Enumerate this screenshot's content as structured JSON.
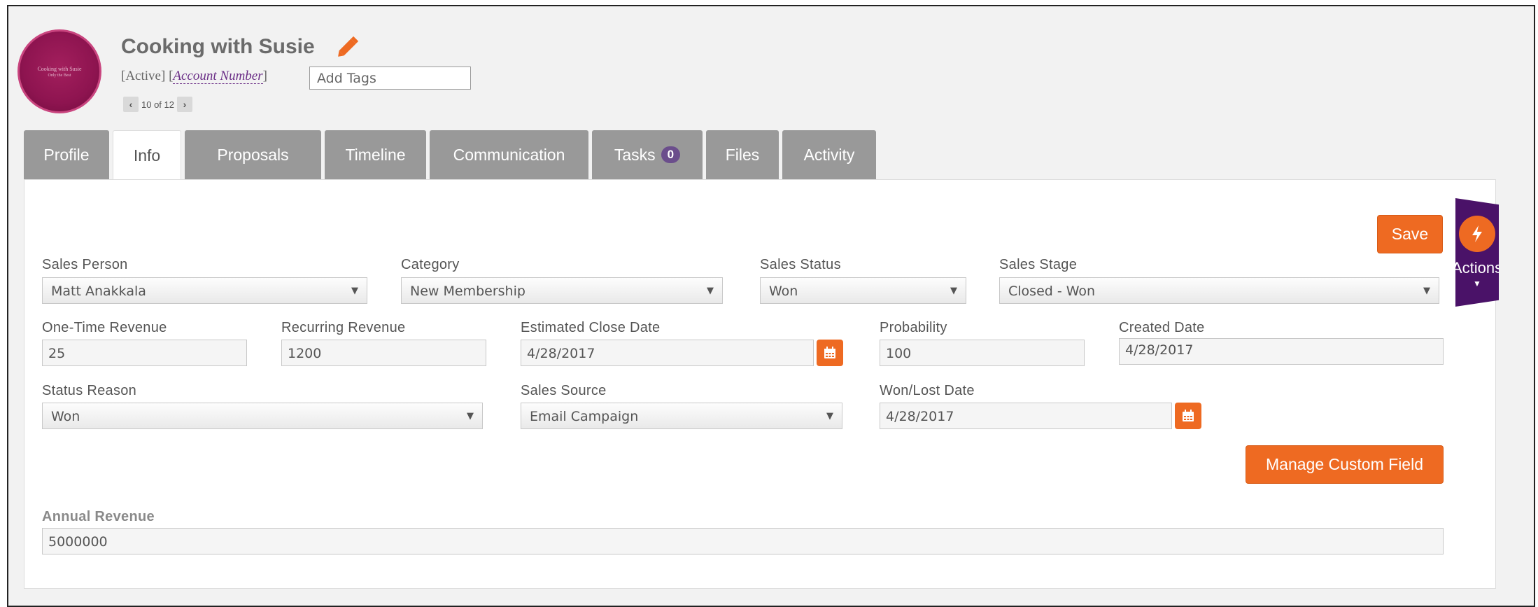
{
  "header": {
    "title": "Cooking with Susie",
    "status": "[Active]",
    "account_number_label": "Account Number",
    "tags_placeholder": "Add Tags",
    "pager_text": "10 of 12",
    "logo_line1": "Cooking with Susie",
    "logo_line2": "Only the Best"
  },
  "tabs": [
    {
      "label": "Profile"
    },
    {
      "label": "Info"
    },
    {
      "label": "Proposals"
    },
    {
      "label": "Timeline"
    },
    {
      "label": "Communication"
    },
    {
      "label": "Tasks",
      "badge": "0"
    },
    {
      "label": "Files"
    },
    {
      "label": "Activity"
    }
  ],
  "active_tab": "Info",
  "form": {
    "sales_person": {
      "label": "Sales Person",
      "value": "Matt Anakkala"
    },
    "category": {
      "label": "Category",
      "value": "New Membership"
    },
    "sales_status": {
      "label": "Sales Status",
      "value": "Won"
    },
    "sales_stage": {
      "label": "Sales Stage",
      "value": "Closed - Won"
    },
    "one_time_revenue": {
      "label": "One-Time Revenue",
      "value": "25"
    },
    "recurring_revenue": {
      "label": "Recurring Revenue",
      "value": "1200"
    },
    "estimated_close_date": {
      "label": "Estimated Close Date",
      "value": "4/28/2017"
    },
    "probability": {
      "label": "Probability",
      "value": "100"
    },
    "created_date": {
      "label": "Created Date",
      "value": "4/28/2017"
    },
    "status_reason": {
      "label": "Status Reason",
      "value": "Won"
    },
    "sales_source": {
      "label": "Sales Source",
      "value": "Email Campaign"
    },
    "won_lost_date": {
      "label": "Won/Lost Date",
      "value": "4/28/2017"
    },
    "annual_revenue": {
      "label": "Annual Revenue",
      "value": "5000000"
    }
  },
  "buttons": {
    "save": "Save",
    "manage_custom_field": "Manage Custom Field",
    "actions": "Actions"
  },
  "colors": {
    "accent": "#ee6a22",
    "brand_purple": "#4a1268",
    "tab_gray": "#999999"
  },
  "icons": [
    "pencil-icon",
    "chevron-left-icon",
    "chevron-right-icon",
    "calendar-icon",
    "lightning-icon",
    "caret-down-icon"
  ]
}
